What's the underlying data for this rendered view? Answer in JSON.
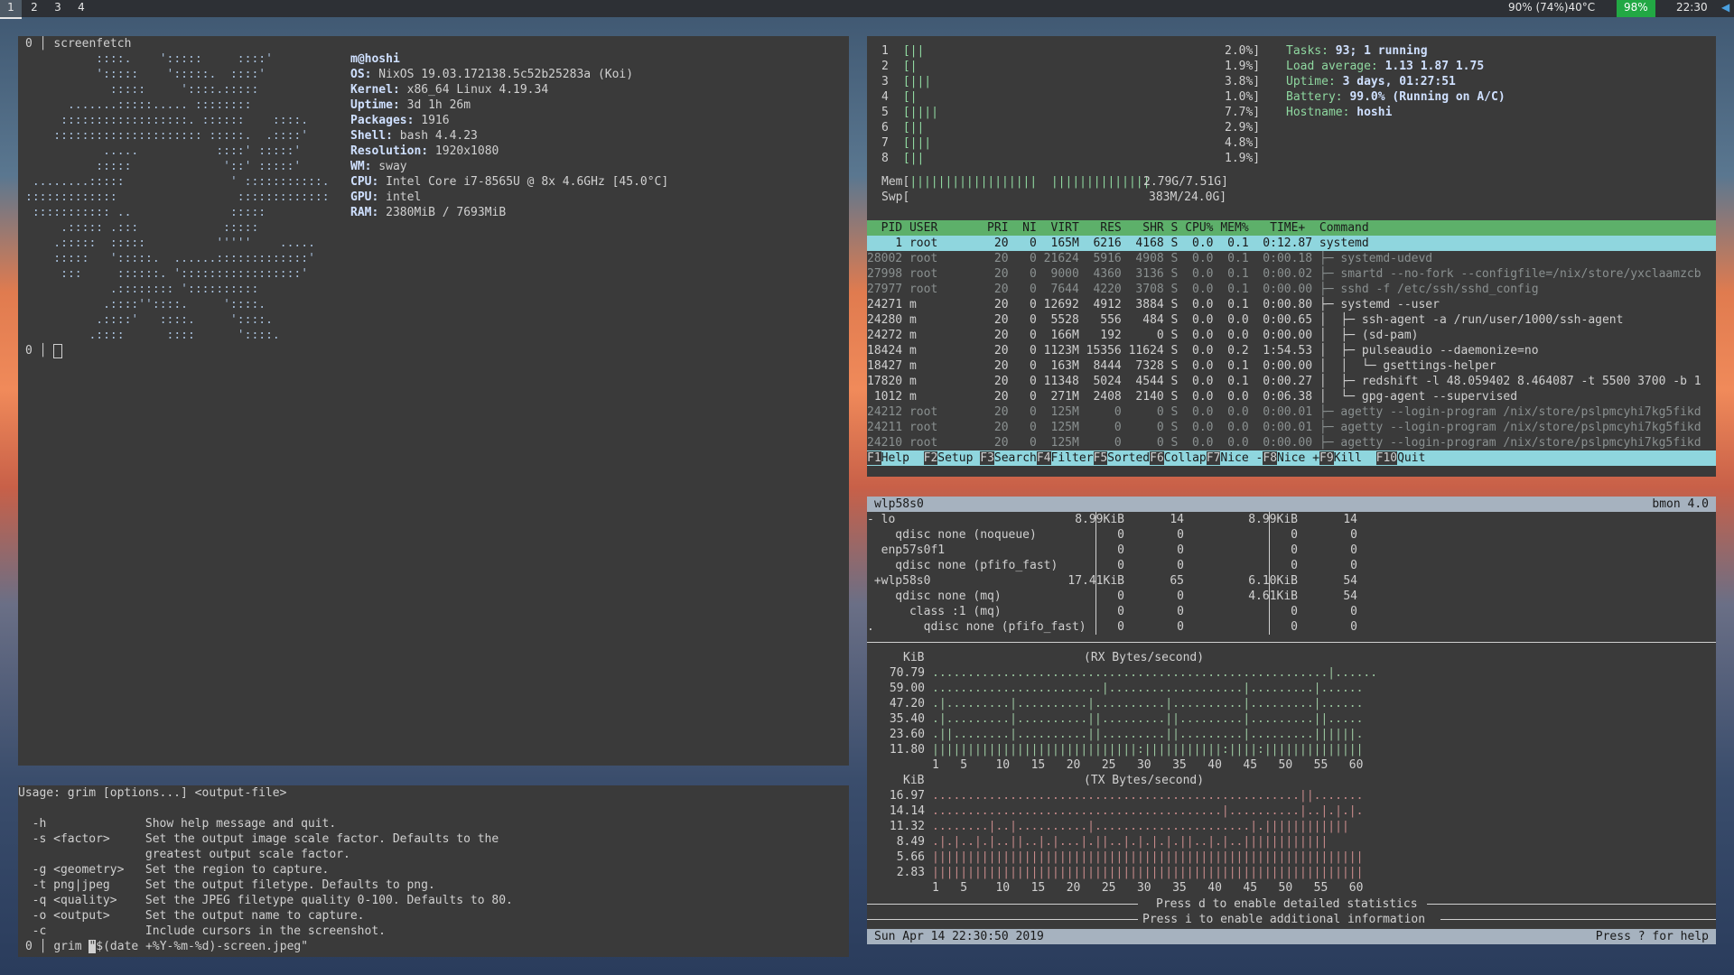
{
  "topbar": {
    "workspaces": [
      "1",
      "2",
      "3",
      "4"
    ],
    "status_temp": "90% (74%)40°C",
    "status_batt": "98%",
    "clock": "22:30",
    "accent": "#22a844"
  },
  "screenfetch": {
    "prompt_num": "0",
    "command": "screenfetch",
    "user": "m@hoshi",
    "ascii": [
      "          ::::.    ':::::     ::::'",
      "          ':::::    ':::::.  ::::'",
      "            :::::     '::::.:::::",
      "      .......:::::..... ::::::::",
      "     ::::::::::::::::::. ::::::    ::::.",
      "    ::::::::::::::::::::: :::::.  .::::'",
      "           .....           ::::' :::::'",
      "          :::::             '::' :::::'",
      " ........:::::               ' :::::::::::.",
      ":::::::::::::                 :::::::::::::",
      " ::::::::::: ..              :::::",
      "     .::::: .:::            :::::",
      "    .:::::  :::::          '''''    .....",
      "    :::::   ':::::.  ......:::::::::::::'",
      "     :::     ::::::. ':::::::::::::::::'",
      "            .:::::::: '::::::::::",
      "           .::::''::::.     '::::.",
      "          .::::'   ::::.     '::::.",
      "         .::::      ::::      '::::."
    ],
    "info": [
      {
        "k": "OS:",
        "v": " NixOS 19.03.172138.5c52b25283a (Koi)"
      },
      {
        "k": "Kernel:",
        "v": " x86_64 Linux 4.19.34"
      },
      {
        "k": "Uptime:",
        "v": " 3d 1h 26m"
      },
      {
        "k": "Packages:",
        "v": " 1916"
      },
      {
        "k": "Shell:",
        "v": " bash 4.4.23"
      },
      {
        "k": "Resolution:",
        "v": " 1920x1080"
      },
      {
        "k": "WM:",
        "v": " sway"
      },
      {
        "k": "CPU:",
        "v": " Intel Core i7-8565U @ 8x 4.6GHz [45.0°C]"
      },
      {
        "k": "GPU:",
        "v": " intel"
      },
      {
        "k": "RAM:",
        "v": " 2380MiB / 7693MiB"
      }
    ],
    "prompt2": "0"
  },
  "grim": {
    "lines": [
      "Usage: grim [options...] <output-file>",
      "",
      "  -h              Show help message and quit.",
      "  -s <factor>     Set the output image scale factor. Defaults to the",
      "                  greatest output scale factor.",
      "  -g <geometry>   Set the region to capture.",
      "  -t png|jpeg     Set the output filetype. Defaults to png.",
      "  -q <quality>    Set the JPEG filetype quality 0-100. Defaults to 80.",
      "  -o <output>     Set the output name to capture.",
      "  -c              Include cursors in the screenshot."
    ],
    "prompt_num": "0",
    "command_pre": "grim ",
    "command_cursor": "\"",
    "command_post": "$(date +%Y-%m-%d)-screen.jpeg\""
  },
  "htop": {
    "cpus": [
      {
        "n": "1",
        "bar": "[||",
        "pct": "2.0%]"
      },
      {
        "n": "2",
        "bar": "[|",
        "pct": "1.9%]"
      },
      {
        "n": "3",
        "bar": "[|||",
        "pct": "3.8%]"
      },
      {
        "n": "4",
        "bar": "[|",
        "pct": "1.0%]"
      },
      {
        "n": "5",
        "bar": "[||||",
        "pct": "7.7%]"
      },
      {
        "n": "6",
        "bar": "[||",
        "pct": "2.9%]"
      },
      {
        "n": "7",
        "bar": "[|||",
        "pct": "4.8%]"
      },
      {
        "n": "8",
        "bar": "[||",
        "pct": "1.9%]"
      }
    ],
    "mem": {
      "label": "Mem[",
      "bar": "||||||||||||||||||  ||||||||||||||",
      "val": "2.79G/7.51G]"
    },
    "swp": {
      "label": "Swp[",
      "val": "383M/24.0G]"
    },
    "summary": [
      {
        "k": "Tasks: ",
        "v": "93; 1 running"
      },
      {
        "k": "Load average: ",
        "v": "1.13 1.87 1.75"
      },
      {
        "k": "Uptime: ",
        "v": "3 days, 01:27:51"
      },
      {
        "k": "Battery: ",
        "v": "99.0% (Running on A/C)"
      },
      {
        "k": "Hostname: ",
        "v": "hoshi"
      }
    ],
    "header": "  PID USER       PRI  NI  VIRT   RES   SHR S CPU% MEM%   TIME+  Command",
    "rows": [
      "    1 root        20   0  165M  6216  4168 S  0.0  0.1  0:12.87 systemd",
      "28002 root        20   0 21624  5916  4908 S  0.0  0.1  0:00.18 ├─ systemd-udevd",
      "27998 root        20   0  9000  4360  3136 S  0.0  0.1  0:00.02 ├─ smartd --no-fork --configfile=/nix/store/yxclaamzcb",
      "27977 root        20   0  7644  4220  3708 S  0.0  0.1  0:00.00 ├─ sshd -f /etc/ssh/sshd_config",
      "24271 m           20   0 12692  4912  3884 S  0.0  0.1  0:00.80 ├─ systemd --user",
      "24280 m           20   0  5528   556   484 S  0.0  0.0  0:00.65 │  ├─ ssh-agent -a /run/user/1000/ssh-agent",
      "24272 m           20   0  166M   192     0 S  0.0  0.0  0:00.00 │  ├─ (sd-pam)",
      "18424 m           20   0 1123M 15356 11624 S  0.0  0.2  1:54.53 │  ├─ pulseaudio --daemonize=no",
      "18427 m           20   0  163M  8444  7328 S  0.0  0.1  0:00.00 │  │  └─ gsettings-helper",
      "17820 m           20   0 11348  5024  4544 S  0.0  0.1  0:00.27 │  ├─ redshift -l 48.059402 8.464087 -t 5500 3700 -b 1",
      " 1012 m           20   0  271M  2408  2140 S  0.0  0.0  0:06.38 │  └─ gpg-agent --supervised",
      "24212 root        20   0  125M     0     0 S  0.0  0.0  0:00.01 ├─ agetty --login-program /nix/store/pslpmcyhi7kg5fikd",
      "24211 root        20   0  125M     0     0 S  0.0  0.0  0:00.01 ├─ agetty --login-program /nix/store/pslpmcyhi7kg5fikd",
      "24210 root        20   0  125M     0     0 S  0.0  0.0  0:00.00 ├─ agetty --login-program /nix/store/pslpmcyhi7kg5fikd"
    ],
    "fkeys": [
      {
        "k": "F1",
        "v": "Help  "
      },
      {
        "k": "F2",
        "v": "Setup "
      },
      {
        "k": "F3",
        "v": "Search"
      },
      {
        "k": "F4",
        "v": "Filter"
      },
      {
        "k": "F5",
        "v": "Sorted"
      },
      {
        "k": "F6",
        "v": "Collap"
      },
      {
        "k": "F7",
        "v": "Nice -"
      },
      {
        "k": "F8",
        "v": "Nice +"
      },
      {
        "k": "F9",
        "v": "Kill  "
      },
      {
        "k": "F10",
        "v": "Quit                                "
      }
    ]
  },
  "bmon": {
    "title": "wlp58s0",
    "version": "bmon 4.0",
    "ifaces": [
      {
        "name": "- lo",
        "rx": "8.99KiB",
        "rxp": "14",
        "tx": "8.99KiB",
        "txp": "14"
      },
      {
        "name": "    qdisc none (noqueue)",
        "rx": "0",
        "rxp": "0",
        "tx": "0",
        "txp": "0"
      },
      {
        "name": "  enp57s0f1",
        "rx": "0",
        "rxp": "0",
        "tx": "0",
        "txp": "0"
      },
      {
        "name": "    qdisc none (pfifo_fast)",
        "rx": "0",
        "rxp": "0",
        "tx": "0",
        "txp": "0"
      },
      {
        "name": " +wlp58s0",
        "rx": "17.41KiB",
        "rxp": "65",
        "tx": "6.10KiB",
        "txp": "54"
      },
      {
        "name": "    qdisc none (mq)",
        "rx": "0",
        "rxp": "0",
        "tx": "4.61KiB",
        "txp": "54"
      },
      {
        "name": "      class :1 (mq)",
        "rx": "0",
        "rxp": "0",
        "tx": "0",
        "txp": "0"
      },
      {
        "name": ".       qdisc none (pfifo_fast)",
        "rx": "0",
        "rxp": "0",
        "tx": "0",
        "txp": "0"
      }
    ],
    "rx_title": "(RX Bytes/second)",
    "tx_title": "(TX Bytes/second)",
    "unit": "KiB",
    "rx_y": [
      "70.79",
      "59.00",
      "47.20",
      "35.40",
      "23.60",
      "11.80"
    ],
    "tx_y": [
      "16.97",
      "14.14",
      "11.32",
      "8.49",
      "5.66",
      "2.83"
    ],
    "rx_rows": [
      "........................................................|......",
      "........................|...................|.........|......",
      ".|.........|..........|..........|..........|.........|......",
      ".|.........|..........||.........||.........|.........||.....",
      ".||........|..........||.........||.........|.........||||||.",
      "|||||||||||||||||||||||||||||:|||||||||||:||||:||||||||||||||"
    ],
    "tx_rows": [
      "....................................................||.......",
      ".........................................|..........|..|.|.|.",
      "........|..|..........|......................|.||||||||||||",
      ".|.|..|.|..||..|.|...|.||..|.|.|.|.||..|.|..||||||||||||",
      "|||||||||||||||||||||||||||||||||||||||||||||||||||||||||||||",
      "|||||||||||||||||||||||||||||||||||||||||||||||||||||||||||||"
    ],
    "x_ticks": "1   5    10   15   20   25   30   35   40   45   50   55   60",
    "msg1": "Press d to enable detailed statistics",
    "msg2": "Press i to enable additional information",
    "footer_date": "Sun Apr 14 22:30:50 2019",
    "footer_help": "Press ? for help"
  }
}
